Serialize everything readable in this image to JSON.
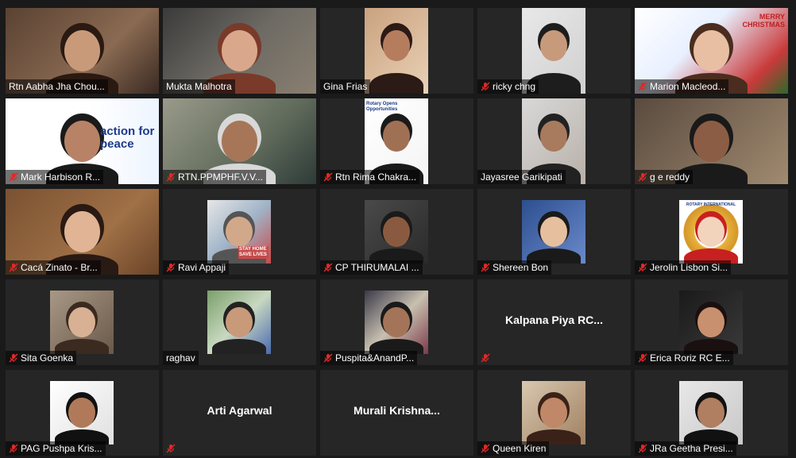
{
  "colors": {
    "background": "#1a1a1a",
    "tile": "#262626",
    "muted_icon": "#e02828",
    "text": "#ffffff"
  },
  "participants": [
    {
      "name": "Rtn Aabha Jha Chou...",
      "muted": false,
      "view": "video"
    },
    {
      "name": "Mukta Malhotra",
      "muted": false,
      "view": "video"
    },
    {
      "name": "Gina Frias",
      "muted": false,
      "view": "video"
    },
    {
      "name": "ricky chng",
      "muted": true,
      "view": "video"
    },
    {
      "name": "Marion Macleod...",
      "muted": true,
      "view": "video",
      "background_text": "MERRY CHRISTMAS"
    },
    {
      "name": "Mark Harbison R...",
      "muted": true,
      "view": "video",
      "background_text": "action for peace"
    },
    {
      "name": "RTN.PPMPHF.V.V...",
      "muted": true,
      "view": "video"
    },
    {
      "name": "Rtn Rima Chakra...",
      "muted": true,
      "view": "video",
      "background_text": "Rotary Opens Opportunities"
    },
    {
      "name": "Jayasree Garikipati",
      "muted": false,
      "view": "video"
    },
    {
      "name": "g e reddy",
      "muted": true,
      "view": "video"
    },
    {
      "name": "Cacá Zinato - Br...",
      "muted": true,
      "view": "video"
    },
    {
      "name": "Ravi Appaji",
      "muted": true,
      "view": "photo",
      "background_text": "STAY HOME SAVE LIVES"
    },
    {
      "name": "CP THIRUMALAI ...",
      "muted": true,
      "view": "photo"
    },
    {
      "name": "Shereen Bon",
      "muted": true,
      "view": "photo"
    },
    {
      "name": "Jerolin Lisbon Si...",
      "muted": true,
      "view": "photo",
      "background_text": "ROTARY INTERNATIONAL"
    },
    {
      "name": "Sita Goenka",
      "muted": true,
      "view": "photo"
    },
    {
      "name": "raghav",
      "muted": false,
      "view": "photo"
    },
    {
      "name": "Puspita&AnandP...",
      "muted": true,
      "view": "photo"
    },
    {
      "name": "",
      "muted": true,
      "view": "name",
      "display_name": "Kalpana  Piya  RC..."
    },
    {
      "name": "Erica Roriz RC E...",
      "muted": true,
      "view": "photo"
    },
    {
      "name": "PAG Pushpa Kris...",
      "muted": true,
      "view": "photo"
    },
    {
      "name": "",
      "muted": true,
      "view": "name",
      "display_name": "Arti Agarwal"
    },
    {
      "name": "",
      "muted": false,
      "view": "name",
      "display_name": "Murali  Krishna..."
    },
    {
      "name": "Queen Kiren",
      "muted": true,
      "view": "photo"
    },
    {
      "name": "JRa Geetha Presi...",
      "muted": true,
      "view": "photo"
    }
  ]
}
